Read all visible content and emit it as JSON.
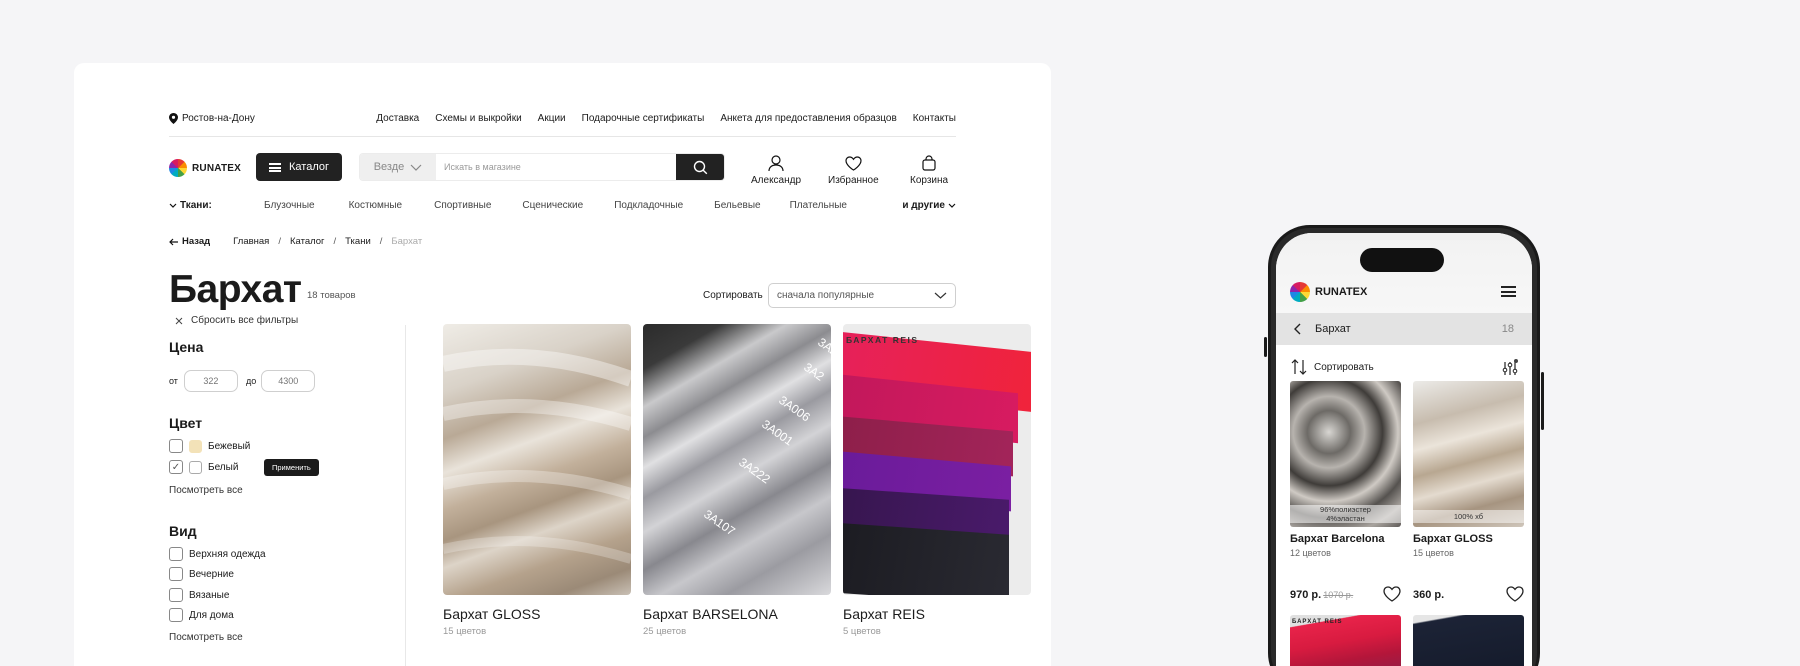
{
  "topbar": {
    "city": "Ростов-на-Дону",
    "links": [
      "Доставка",
      "Схемы и выкройки",
      "Акции",
      "Подарочные сертификаты",
      "Анкета для предоставления образцов",
      "Контакты"
    ]
  },
  "header": {
    "logo": "RUNATEX",
    "catalog_label": "Каталог",
    "search_scope": "Везде",
    "search_placeholder": "Искать в магазине",
    "account_label": "Александр",
    "favorites_label": "Избранное",
    "cart_label": "Корзина"
  },
  "categories": {
    "lead": "Ткани:",
    "items": [
      "Блузочные",
      "Костюмные",
      "Спортивные",
      "Сценические",
      "Подкладочные",
      "Бельевые",
      "Плательные"
    ],
    "more": "и другие"
  },
  "breadcrumb": {
    "back": "Назад",
    "items": [
      "Главная",
      "Каталог",
      "Ткани",
      "Бархат"
    ]
  },
  "page": {
    "title": "Бархат",
    "count": "18 товаров",
    "sort_label": "Сортировать",
    "sort_value": "сначала популярные"
  },
  "filters": {
    "reset": "Сбросить все фильтры",
    "price": {
      "title": "Цена",
      "from_label": "от",
      "from_placeholder": "322",
      "to_label": "до",
      "to_placeholder": "4300"
    },
    "color": {
      "title": "Цвет",
      "options": [
        {
          "label": "Бежевый",
          "checked": false,
          "swatch": "#f3e2b8"
        },
        {
          "label": "Белый",
          "checked": true,
          "swatch": "#ffffff"
        }
      ],
      "apply": "Применить",
      "see_all": "Посмотреть все"
    },
    "kind": {
      "title": "Вид",
      "options": [
        "Верхняя одежда",
        "Вечерние",
        "Вязаные",
        "Для дома"
      ],
      "see_all": "Посмотреть все"
    }
  },
  "products": [
    {
      "name": "Бархат GLOSS",
      "colors": "15 цветов"
    },
    {
      "name": "Бархат BARSELONA",
      "colors": "25 цветов",
      "tags": [
        "3A2",
        "3A006",
        "3A001",
        "3A222",
        "3A107"
      ]
    },
    {
      "name": "Бархат REIS",
      "colors": "5 цветов",
      "brand": "БАРХАТ REIS"
    }
  ],
  "mobile": {
    "logo": "RUNATEX",
    "crumb_title": "Бархат",
    "crumb_count": "18",
    "sort_label": "Сортировать",
    "products": [
      {
        "name": "Бархат Barcelona",
        "colors": "12 цветов",
        "badge_line1": "96%полиэстер",
        "badge_line2": "4%эластан",
        "price": "970 р.",
        "old_price": "1070 р."
      },
      {
        "name": "Бархат GLOSS",
        "colors": "15 цветов",
        "badge_line1": "100% хб",
        "badge_line2": "",
        "price": "360 р.",
        "old_price": ""
      }
    ],
    "row2_brand": "БАРХАТ REIS"
  }
}
